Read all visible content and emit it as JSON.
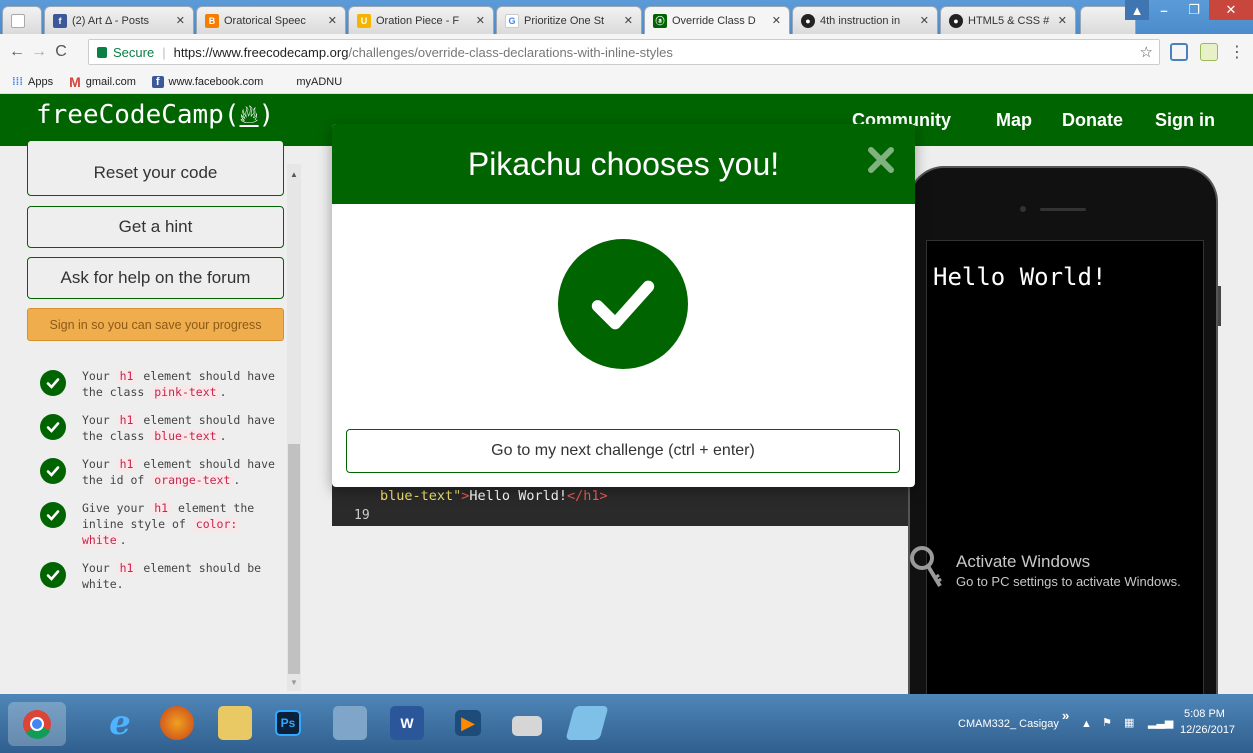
{
  "browser": {
    "tabs": [
      {
        "title": "",
        "favicon": "blank-page-icon",
        "color": "#dddddd"
      },
      {
        "title": "(2) Art Δ - Posts",
        "favicon": "facebook-icon",
        "color": "#3b5998"
      },
      {
        "title": "Oratorical Speec",
        "favicon": "blogger-icon",
        "color": "#f57d00"
      },
      {
        "title": "Oration Piece - F",
        "favicon": "document-icon",
        "color": "#f5b400"
      },
      {
        "title": "Prioritize One St",
        "favicon": "google-icon",
        "color": "#4285f4"
      },
      {
        "title": "Override Class D",
        "favicon": "freecodecamp-icon",
        "color": "#006400"
      },
      {
        "title": "4th instruction in",
        "favicon": "github-icon",
        "color": "#222222"
      },
      {
        "title": "HTML5 & CSS #",
        "favicon": "github-icon",
        "color": "#222222"
      }
    ],
    "secure_label": "Secure",
    "url_host": "https://www.freecodecamp.org",
    "url_path": "/challenges/override-class-declarations-with-inline-styles",
    "bookmarks": [
      {
        "label": "Apps",
        "icon": "apps-grid-icon"
      },
      {
        "label": "gmail.com",
        "icon": "gmail-icon"
      },
      {
        "label": "www.facebook.com",
        "icon": "facebook-icon"
      },
      {
        "label": "myADNU",
        "icon": "blank-page-icon"
      }
    ]
  },
  "fcc": {
    "logo_text": "freeCodeCamp(",
    "logo_close": ")",
    "nav": [
      "Community",
      "Map",
      "Donate",
      "Sign in"
    ],
    "brand_color": "#006400"
  },
  "left": {
    "reset": "Reset your code",
    "hint": "Get a hint",
    "forum": "Ask for help on the forum",
    "signin": "Sign in so you can save your progress",
    "tests": [
      {
        "pre": "Your ",
        "code": "h1",
        "mid": " element should have the class ",
        "code2": "pink-text",
        "post": "."
      },
      {
        "pre": "Your ",
        "code": "h1",
        "mid": " element should have the class ",
        "code2": "blue-text",
        "post": "."
      },
      {
        "pre": "Your ",
        "code": "h1",
        "mid": " element should have the id of ",
        "code2": "orange-text",
        "post": "."
      },
      {
        "pre": "Give your ",
        "code": "h1",
        "mid": " element the inline style of ",
        "code2": "color: white",
        "post": "."
      },
      {
        "pre": "Your ",
        "code": "h1",
        "mid": " element should be white.",
        "code2": "",
        "post": ""
      }
    ]
  },
  "editor": {
    "attr_text": "blue-text\"",
    "gt": ">",
    "content": "Hello World!",
    "close_tag": "</h1>",
    "line_number": "19"
  },
  "preview": {
    "heading": "Hello World!",
    "watermark_title": "Activate Windows",
    "watermark_sub": "Go to PC settings to activate Windows."
  },
  "modal": {
    "title": "Pikachu chooses you!",
    "next_button": "Go to my next challenge (ctrl + enter)"
  },
  "taskbar": {
    "user": "CMAM332_ Casigay",
    "chevron": "»",
    "time": "5:08 PM",
    "date": "12/26/2017"
  }
}
